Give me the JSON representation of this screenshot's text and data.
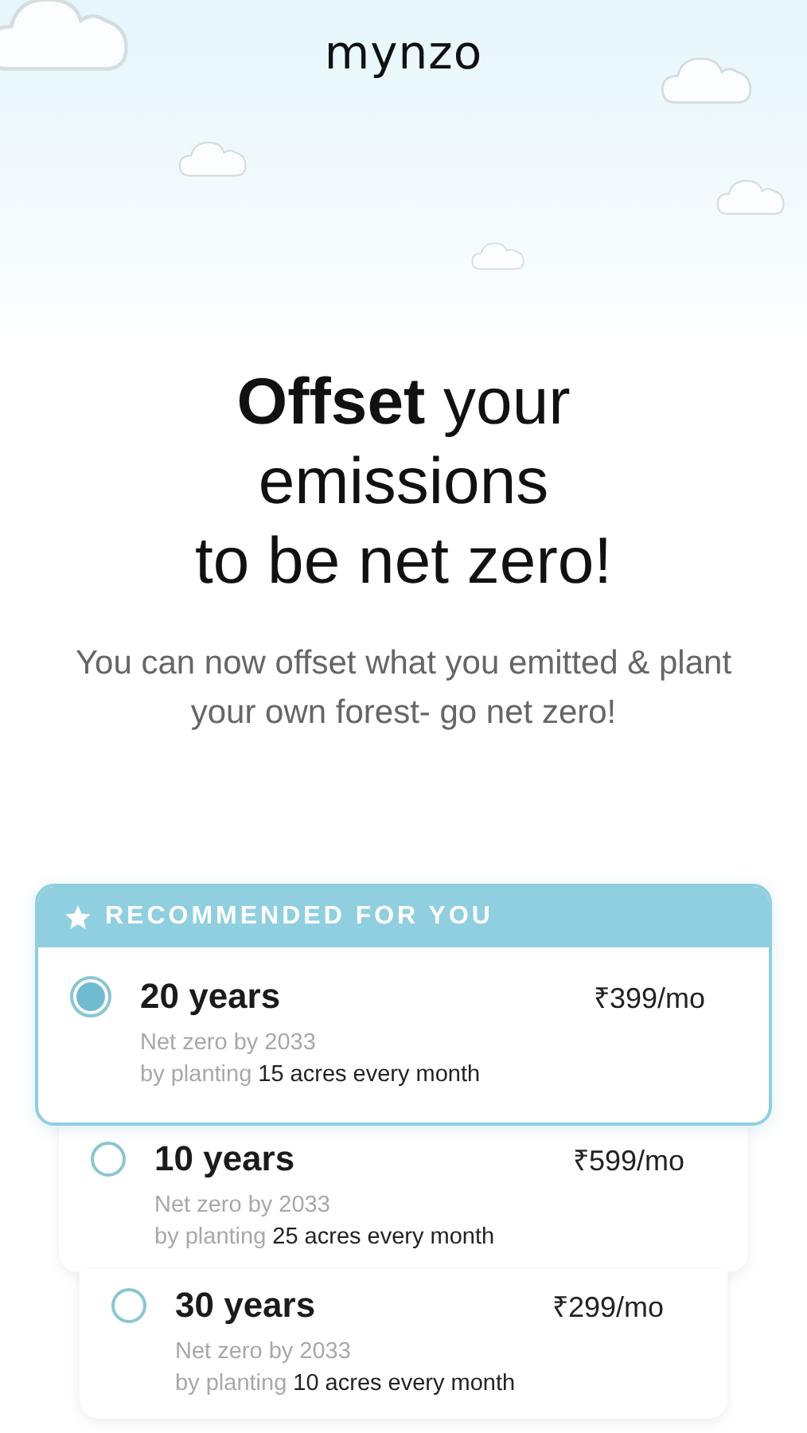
{
  "logo": "mynzo",
  "heading_lines": [
    "**Offset** your",
    "emissions",
    "to be net zero!"
  ],
  "subtitle": "You can now offset what you emitted & plant your own forest- go net zero!",
  "recommended_label": "RECOMMENDED FOR YOU",
  "plans": [
    {
      "title": "20 years",
      "price": "₹399/mo",
      "net_zero": "Net zero by 2033",
      "planting_prefix": "by planting",
      "planting_amount": "15 acres every month",
      "selected": true,
      "recommended": true
    },
    {
      "title": "10 years",
      "price": "₹599/mo",
      "net_zero": "Net zero by 2033",
      "planting_prefix": "by planting",
      "planting_amount": "25 acres every month",
      "selected": false,
      "recommended": false
    },
    {
      "title": "30 years",
      "price": "₹299/mo",
      "net_zero": "Net zero by 2033",
      "planting_prefix": "by planting",
      "planting_amount": "10 acres every month",
      "selected": false,
      "recommended": false
    }
  ]
}
